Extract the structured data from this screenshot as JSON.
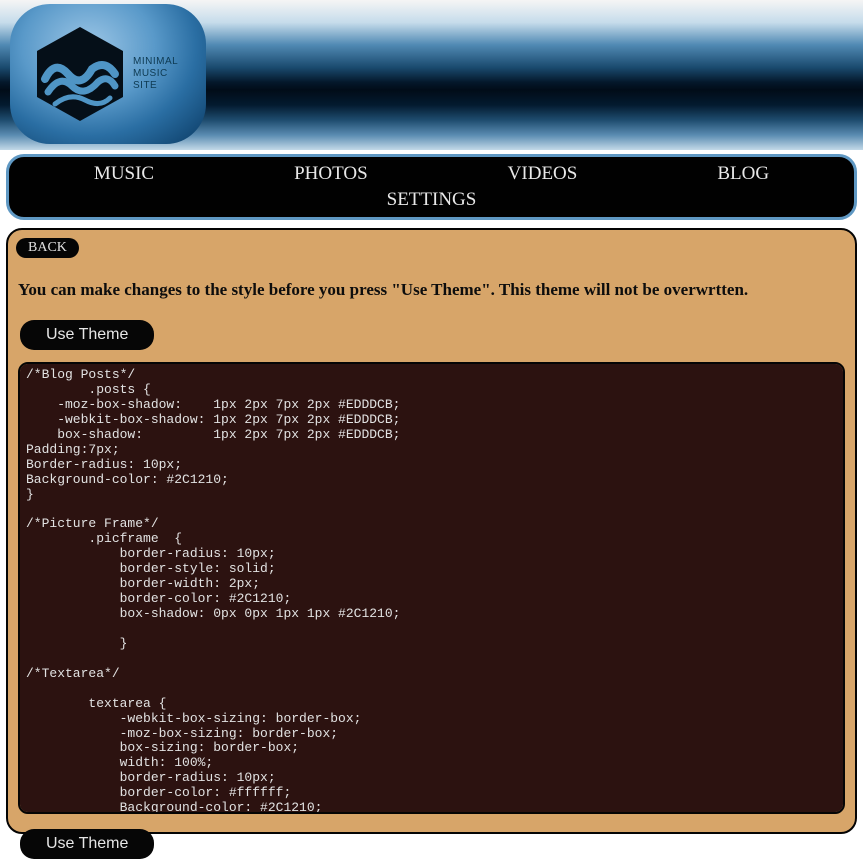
{
  "logo": {
    "line1": "MINIMAL",
    "line2": "MUSIC",
    "line3": "SITE"
  },
  "nav": {
    "music": "MUSIC",
    "photos": "PHOTOS",
    "videos": "VIDEOS",
    "blog": "BLOG",
    "settings": "SETTINGS"
  },
  "panel": {
    "back_label": "BACK",
    "title": "You can make changes to the style before you press \"Use Theme\". This theme will not be overwrtten.",
    "use_theme_label": "Use Theme",
    "editor_content": "/*Blog Posts*/\n        .posts {\n    -moz-box-shadow:    1px 2px 7px 2px #EDDDCB;\n    -webkit-box-shadow: 1px 2px 7px 2px #EDDDCB;\n    box-shadow:         1px 2px 7px 2px #EDDDCB;\nPadding:7px;\nBorder-radius: 10px;\nBackground-color: #2C1210;\n}\n\n/*Picture Frame*/\n        .picframe  {\n            border-radius: 10px;\n            border-style: solid;\n            border-width: 2px;\n            border-color: #2C1210;\n            box-shadow: 0px 0px 1px 1px #2C1210;\n\n            }\n\n/*Textarea*/\n\n        textarea {\n            -webkit-box-sizing: border-box;\n            -moz-box-sizing: border-box;\n            box-sizing: border-box;\n            width: 100%;\n            border-radius: 10px;\n            border-color: #ffffff;\n            Background-color: #2C1210;"
  }
}
